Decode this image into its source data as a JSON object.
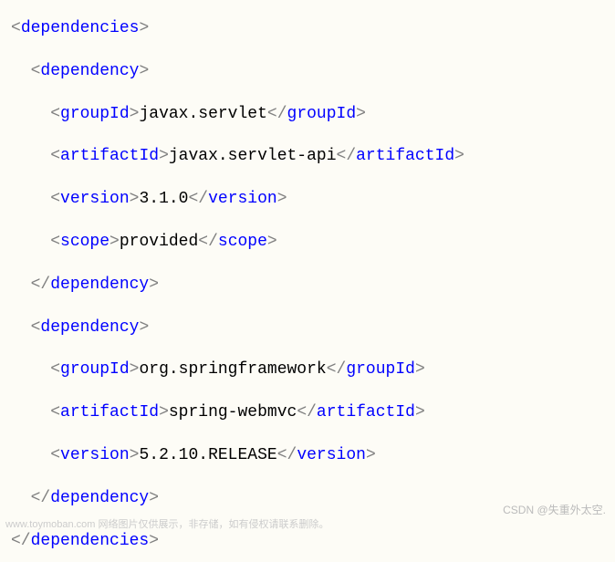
{
  "code": {
    "root_open": "dependencies",
    "root_close": "dependencies",
    "dep_open": "dependency",
    "dep_close": "dependency",
    "deps": [
      {
        "fields": [
          {
            "tag": "groupId",
            "value": "javax.servlet"
          },
          {
            "tag": "artifactId",
            "value": "javax.servlet-api"
          },
          {
            "tag": "version",
            "value": "3.1.0"
          },
          {
            "tag": "scope",
            "value": "provided"
          }
        ]
      },
      {
        "fields": [
          {
            "tag": "groupId",
            "value": "org.springframework"
          },
          {
            "tag": "artifactId",
            "value": "spring-webmvc"
          },
          {
            "tag": "version",
            "value": "5.2.10.RELEASE"
          }
        ]
      }
    ]
  },
  "watermark": {
    "right": "CSDN @失重外太空.",
    "bottom": "www.toymoban.com 网络图片仅供展示，非存储，如有侵权请联系删除。"
  }
}
